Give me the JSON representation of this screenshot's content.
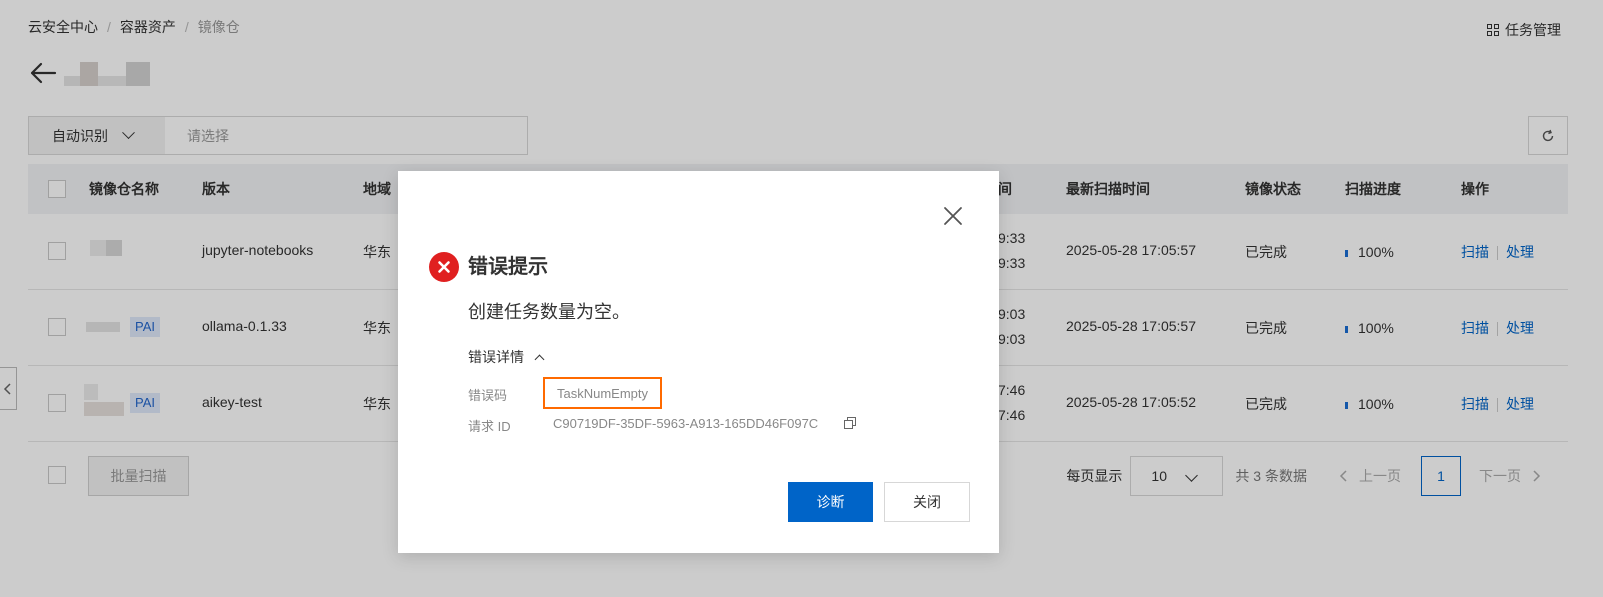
{
  "breadcrumb": [
    "云安全中心",
    "容器资产",
    "镜像仓"
  ],
  "header": {
    "task_management": "任务管理"
  },
  "filter": {
    "select_value": "自动识别",
    "placeholder": "请选择"
  },
  "table": {
    "columns": [
      "镜像仓名称",
      "版本",
      "地域",
      "间",
      "最新扫描时间",
      "镜像状态",
      "扫描进度",
      "操作"
    ],
    "rows": [
      {
        "tag": "",
        "version": "jupyter-notebooks",
        "region": "华东",
        "time_a": "9:33",
        "time_b": "9:33",
        "last_scan": "2025-05-28 17:05:57",
        "status": "已完成",
        "progress": "100%",
        "action_scan": "扫描",
        "action_handle": "处理"
      },
      {
        "tag": "PAI",
        "version": "ollama-0.1.33",
        "region": "华东",
        "time_a": "9:03",
        "time_b": "9:03",
        "last_scan": "2025-05-28 17:05:57",
        "status": "已完成",
        "progress": "100%",
        "action_scan": "扫描",
        "action_handle": "处理"
      },
      {
        "tag": "PAI",
        "version": "aikey-test",
        "region": "华东",
        "time_a": "7:46",
        "time_b": "7:46",
        "last_scan": "2025-05-28 17:05:52",
        "status": "已完成",
        "progress": "100%",
        "action_scan": "扫描",
        "action_handle": "处理"
      }
    ]
  },
  "footer": {
    "batch_scan": "批量扫描",
    "per_page_label": "每页显示",
    "per_page_value": "10",
    "total": "共 3 条数据",
    "prev": "上一页",
    "page": "1",
    "next": "下一页"
  },
  "modal": {
    "title": "错误提示",
    "message": "创建任务数量为空。",
    "detail_toggle": "错误详情",
    "error_code_label": "错误码",
    "error_code_value": "TaskNumEmpty",
    "request_id_label": "请求 ID",
    "request_id_value": "C90719DF-35DF-5963-A913-165DD46F097C",
    "diagnose_button": "诊断",
    "close_button": "关闭",
    "highlight_color": "#ff6a00"
  },
  "colors": {
    "primary": "#0064c8",
    "error": "#e02020"
  }
}
